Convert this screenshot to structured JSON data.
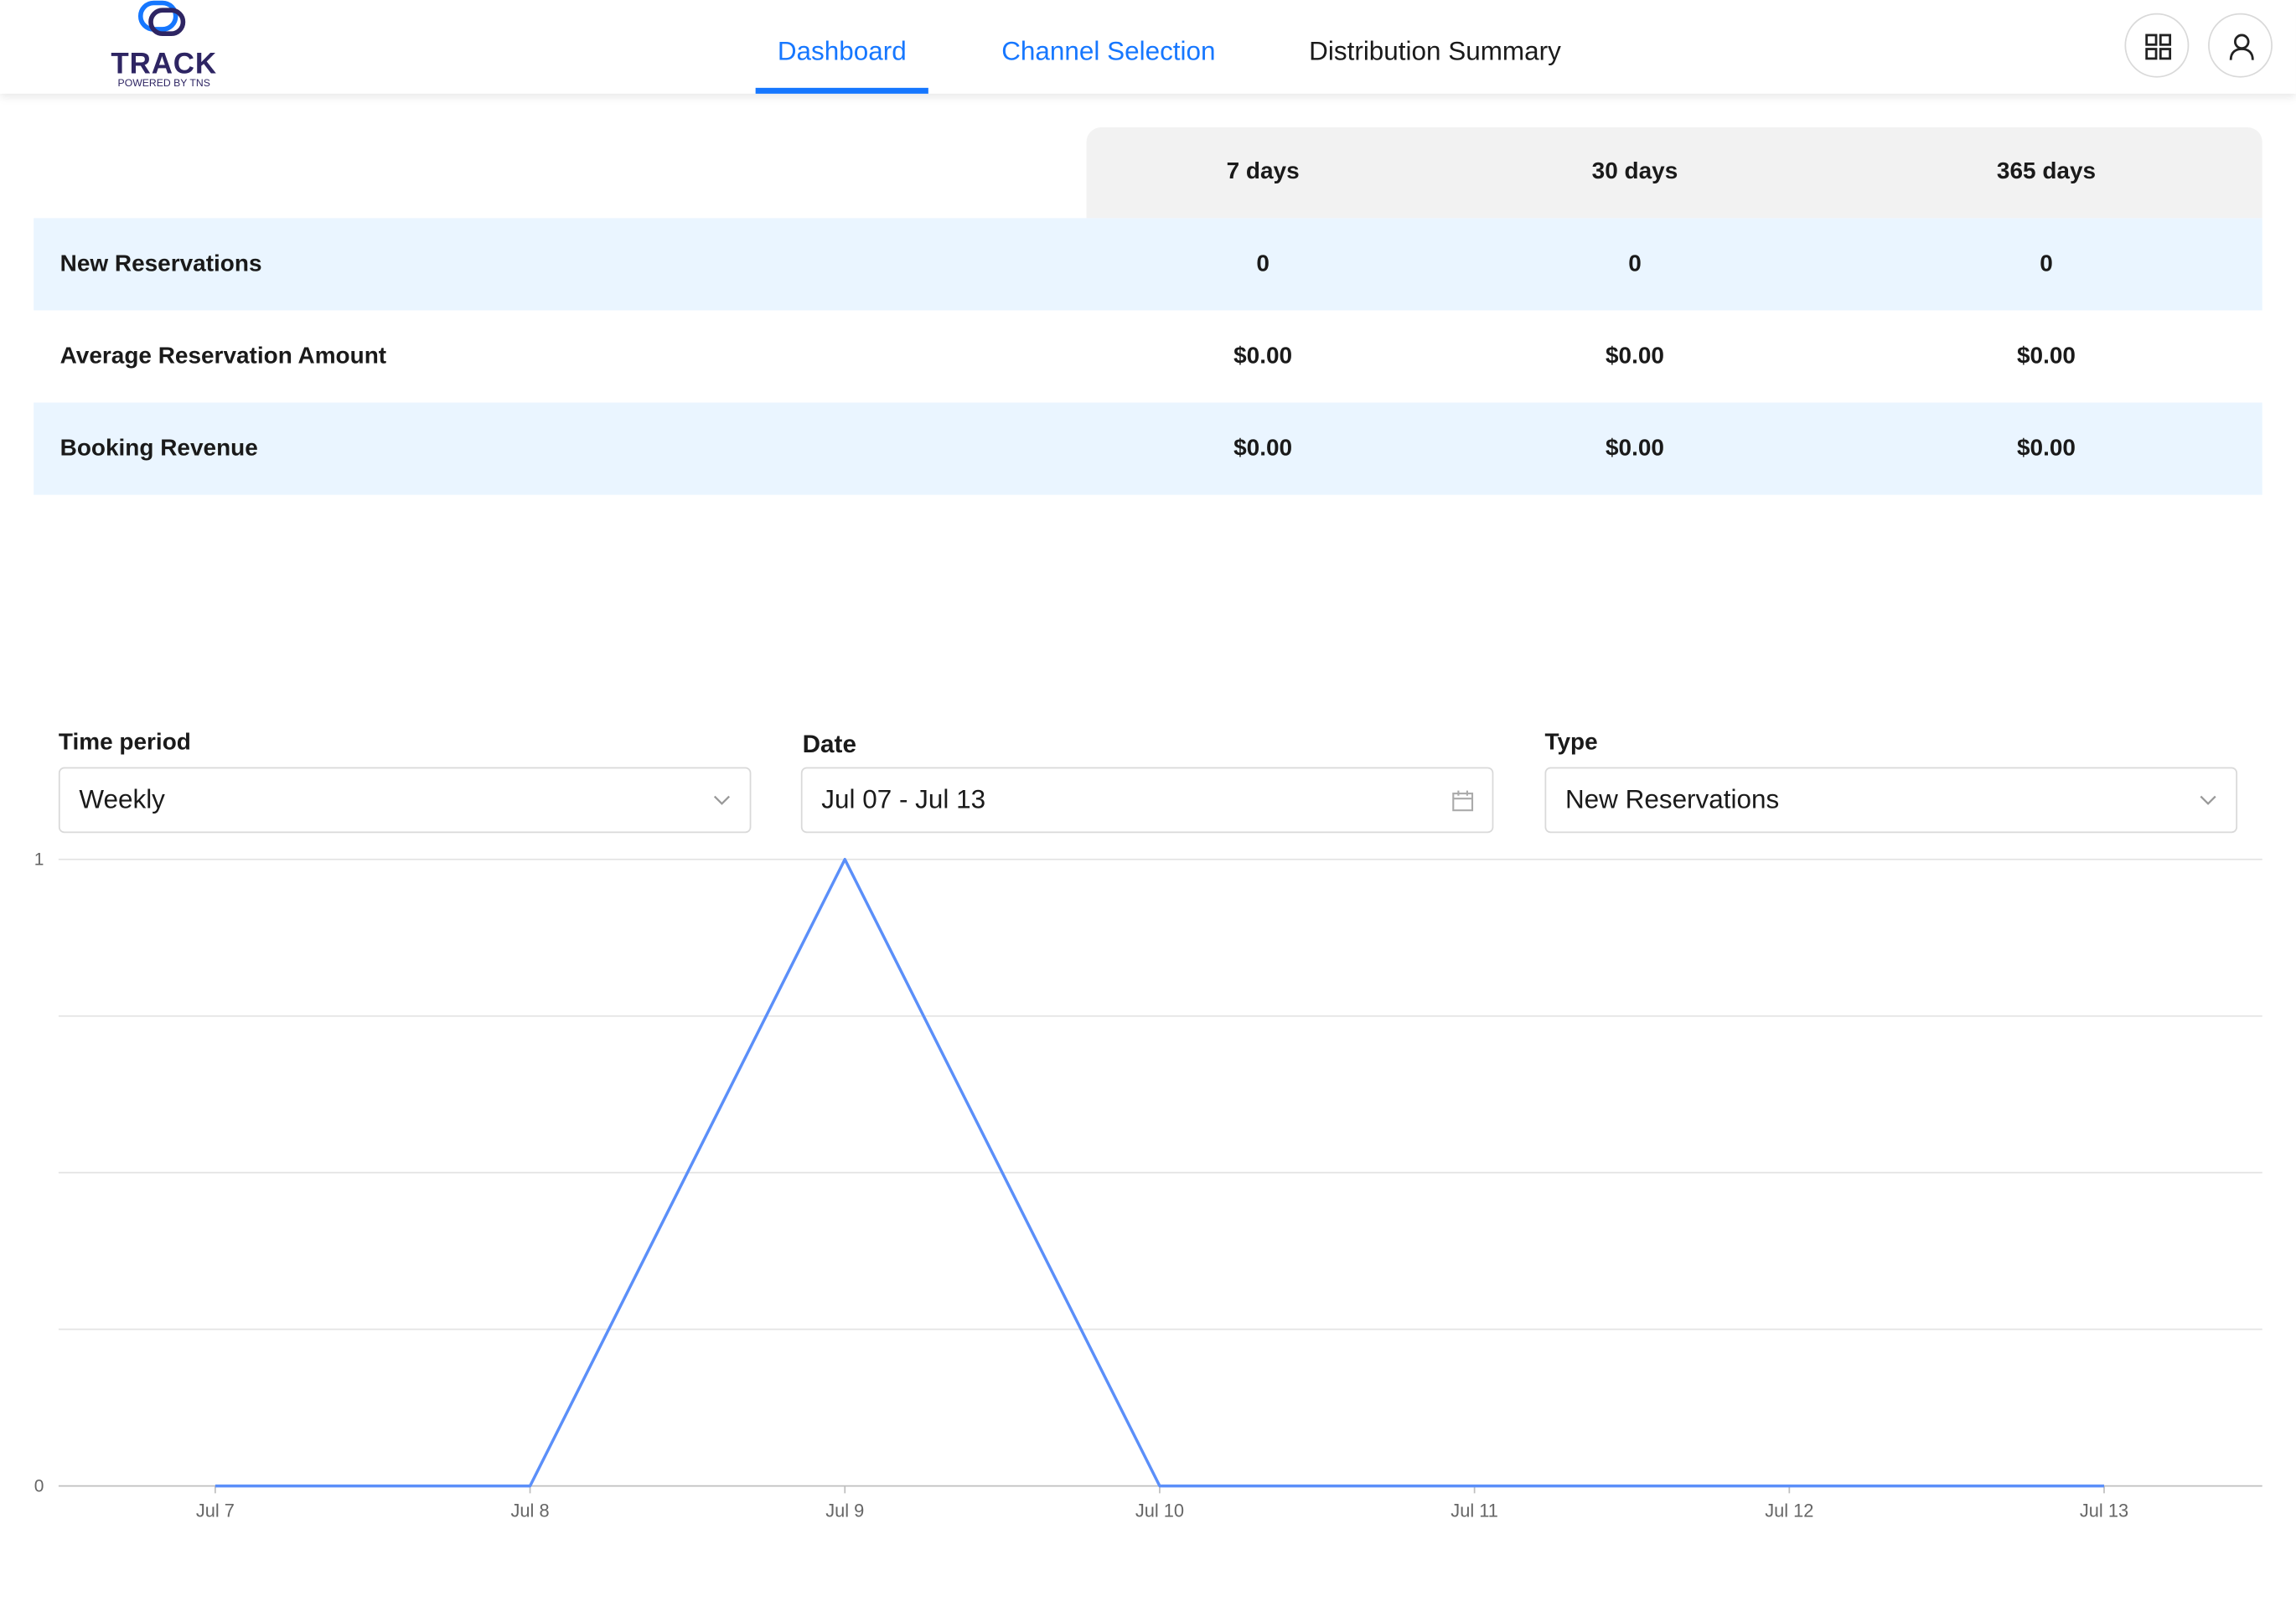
{
  "brand": {
    "name": "TRACK",
    "tagline": "POWERED BY TNS"
  },
  "nav": {
    "tabs": [
      {
        "label": "Dashboard",
        "active": true
      },
      {
        "label": "Channel Selection",
        "active": false
      },
      {
        "label": "Distribution Summary",
        "active": false
      }
    ],
    "apps_icon": "grid-icon",
    "account_icon": "user-icon"
  },
  "summary": {
    "columns": [
      "7 days",
      "30 days",
      "365 days"
    ],
    "rows": [
      {
        "label": "New Reservations",
        "values": [
          "0",
          "0",
          "0"
        ]
      },
      {
        "label": "Average Reservation Amount",
        "values": [
          "$0.00",
          "$0.00",
          "$0.00"
        ]
      },
      {
        "label": "Booking Revenue",
        "values": [
          "$0.00",
          "$0.00",
          "$0.00"
        ]
      }
    ]
  },
  "filters": {
    "time_period": {
      "label": "Time period",
      "value": "Weekly"
    },
    "date": {
      "label": "Date",
      "value": "Jul 07 - Jul 13"
    },
    "type": {
      "label": "Type",
      "value": "New Reservations"
    }
  },
  "colors": {
    "accent": "#1677ff",
    "row_highlight": "#eaf5ff",
    "line": "#5b8ff9"
  },
  "chart_data": {
    "type": "line",
    "x": [
      "Jul 7",
      "Jul 8",
      "Jul 9",
      "Jul 10",
      "Jul 11",
      "Jul 12",
      "Jul 13"
    ],
    "series": [
      {
        "values": [
          0,
          0,
          1,
          0,
          0,
          0,
          0
        ]
      }
    ],
    "ylim": [
      0,
      1
    ],
    "yticks": [
      "0",
      "1"
    ],
    "grid": true,
    "title": "",
    "xlabel": "",
    "ylabel": ""
  }
}
